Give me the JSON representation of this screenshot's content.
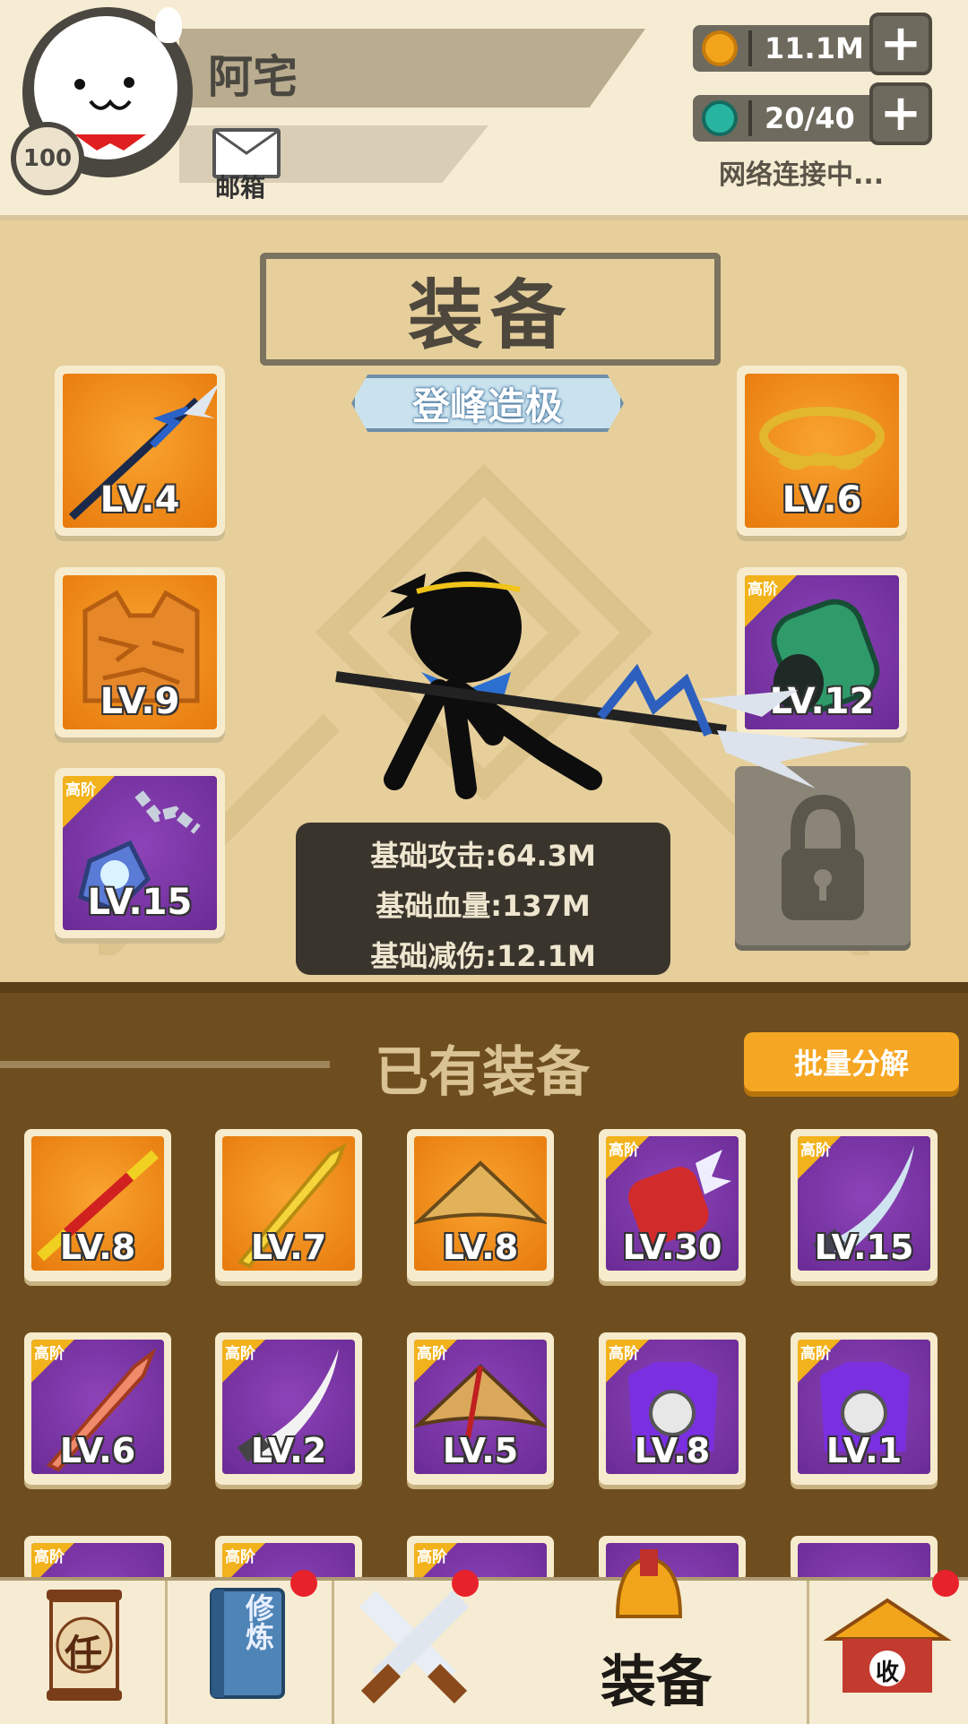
{
  "player": {
    "name": "阿宅",
    "level": "100",
    "mail_label": "邮箱"
  },
  "resources": {
    "coins": "11.1M",
    "gems": "20/40",
    "network_status": "网络连接中..."
  },
  "equipment": {
    "title": "装备",
    "rank": "登峰造极",
    "slots_left": [
      {
        "kind": "spear",
        "level": "LV.4",
        "tier": ""
      },
      {
        "kind": "armor",
        "level": "LV.9",
        "tier": ""
      },
      {
        "kind": "amulet",
        "level": "LV.15",
        "tier": "高阶"
      }
    ],
    "slots_right": [
      {
        "kind": "headband",
        "level": "LV.6",
        "tier": ""
      },
      {
        "kind": "bracer",
        "level": "LV.12",
        "tier": "高阶"
      }
    ],
    "stats": [
      "基础攻击:64.3M",
      "基础血量:137M",
      "基础减伤:12.1M"
    ]
  },
  "owned": {
    "title": "已有装备",
    "bulk_button": "批量分解",
    "items": [
      {
        "level": "LV.8",
        "tier": "",
        "kind": "staff"
      },
      {
        "level": "LV.7",
        "tier": "",
        "kind": "sword"
      },
      {
        "level": "LV.8",
        "tier": "",
        "kind": "hat"
      },
      {
        "level": "LV.30",
        "tier": "高阶",
        "kind": "gauntlet"
      },
      {
        "level": "LV.15",
        "tier": "高阶",
        "kind": "blade"
      },
      {
        "level": "LV.6",
        "tier": "高阶",
        "kind": "sword"
      },
      {
        "level": "LV.2",
        "tier": "高阶",
        "kind": "blade"
      },
      {
        "level": "LV.5",
        "tier": "高阶",
        "kind": "hat"
      },
      {
        "level": "LV.8",
        "tier": "高阶",
        "kind": "armor"
      },
      {
        "level": "LV.1",
        "tier": "高阶",
        "kind": "armor"
      }
    ],
    "partial_tiers": [
      "高阶",
      "高阶",
      "高阶",
      "",
      ""
    ]
  },
  "nav": {
    "tab1_icon_text": "任",
    "tab2_icon_text": "修炼",
    "active_label": "装备",
    "tab5_icon_text": "收"
  },
  "colors": {
    "orange_rarity": "#f39118",
    "purple_rarity": "#7a36a6",
    "tier_badge": "#f2b21b"
  }
}
